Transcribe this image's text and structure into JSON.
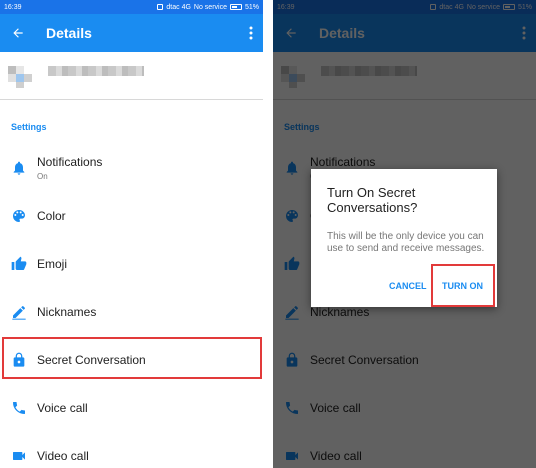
{
  "status_bar": {
    "time": "16:39",
    "network": "dtac 4G",
    "service": "No service",
    "battery": "51%"
  },
  "app_bar": {
    "title": "Details"
  },
  "settings": {
    "section_label": "Settings",
    "items": [
      {
        "label": "Notifications",
        "sub": "On",
        "icon": "bell-icon"
      },
      {
        "label": "Color",
        "icon": "palette-icon"
      },
      {
        "label": "Emoji",
        "icon": "thumbs-up-icon"
      },
      {
        "label": "Nicknames",
        "icon": "pencil-icon"
      },
      {
        "label": "Secret Conversation",
        "icon": "lock-icon"
      },
      {
        "label": "Voice call",
        "icon": "phone-icon"
      },
      {
        "label": "Video call",
        "icon": "video-camera-icon"
      }
    ]
  },
  "dialog": {
    "title": "Turn On Secret Conversations?",
    "body": "This will be the only device you can use to send and receive messages.",
    "cancel_label": "CANCEL",
    "confirm_label": "TURN ON"
  },
  "colors": {
    "accent": "#1a8cf1",
    "status_bar": "#1a73e8",
    "highlight": "#e23a3a",
    "scrim": "rgba(0,0,0,0.62)"
  }
}
